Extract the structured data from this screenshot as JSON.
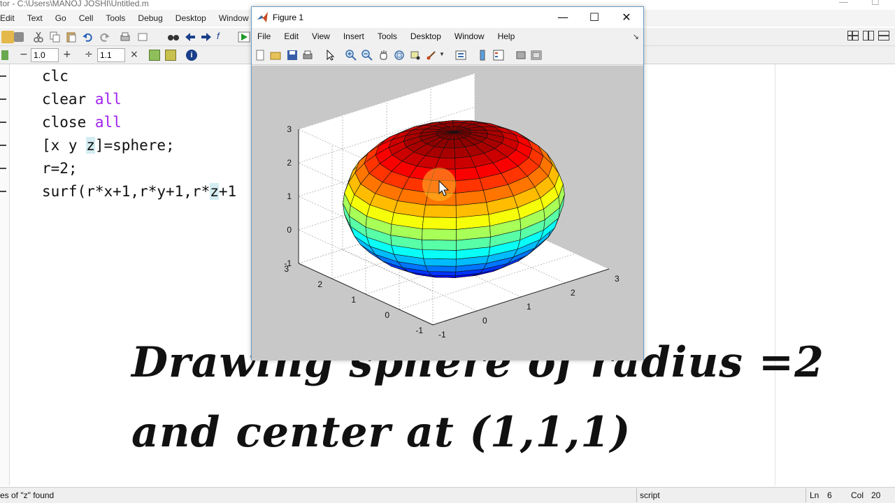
{
  "editor": {
    "title": "tor - C:\\Users\\MANOJ JOSHI\\Untitled.m",
    "menu": [
      "Edit",
      "Text",
      "Go",
      "Cell",
      "Tools",
      "Debug",
      "Desktop",
      "Window"
    ],
    "cell_toolbar": {
      "minus": "−",
      "value1": "1.0",
      "plus": "+",
      "divide": "÷",
      "value2": "1.1",
      "times": "×"
    },
    "code": {
      "line1": "clc",
      "line2_cmd": "clear ",
      "line2_kw": "all",
      "line3_cmd": "close ",
      "line3_kw": "all",
      "line4_a": "[x y ",
      "line4_hl": "z",
      "line4_b": "]=sphere;",
      "line5": "r=2;",
      "line6_a": "surf(r*x+1,r*y+1,r*",
      "line6_hl": "z",
      "line6_b": "+1"
    }
  },
  "figure": {
    "title": "Figure 1",
    "menu": [
      "File",
      "Edit",
      "View",
      "Insert",
      "Tools",
      "Desktop",
      "Window",
      "Help"
    ],
    "window_controls": {
      "minimize": "—",
      "maximize": "☐",
      "close": "✕"
    },
    "axis_ticks": {
      "z": [
        "3",
        "2",
        "1",
        "0",
        "-1"
      ],
      "y": [
        "3",
        "2",
        "1",
        "0",
        "-1"
      ],
      "x": [
        "-1",
        "0",
        "1",
        "2",
        "3"
      ]
    }
  },
  "caption": {
    "line1": "Drawing sphere of radius =2",
    "line2": "and center at (1,1,1)"
  },
  "status": {
    "message": "es of \"z\" found",
    "mode": "script",
    "ln_label": "Ln",
    "ln_value": "6",
    "col_label": "Col",
    "col_value": "20"
  },
  "colors": {
    "keyword": "#a020f0",
    "highlight": "#d3ecf2",
    "plot_background": "#c8c8c8"
  }
}
